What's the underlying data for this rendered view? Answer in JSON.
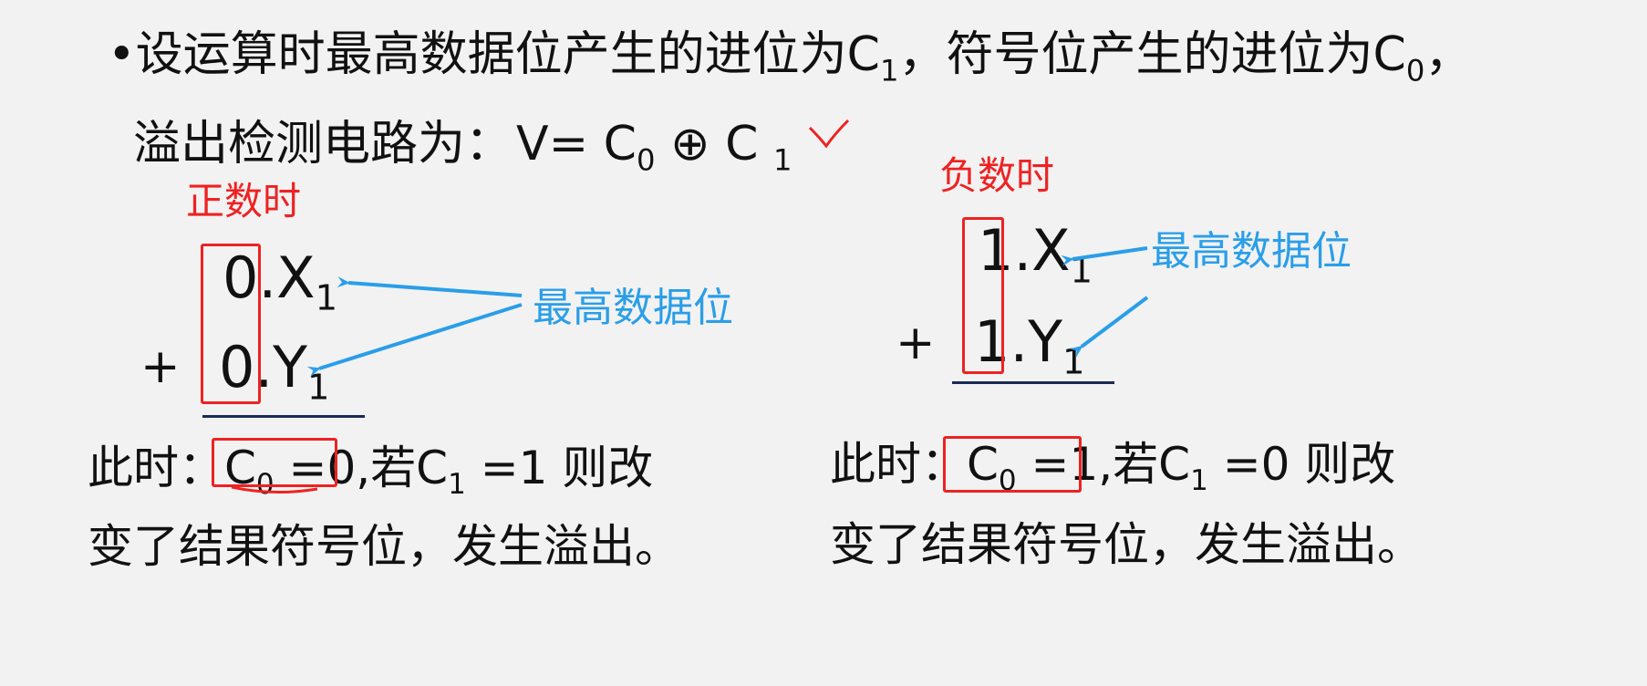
{
  "line1": {
    "bullet": "•",
    "a": "设运算时最高数据位产生的进位为C",
    "a_sub": "1",
    "b": "，符号位产生的进位为C",
    "b_sub": "0",
    "c": "，"
  },
  "line2": {
    "label": "溢出检测电路为：",
    "formula_pre": "V= C",
    "formula_sub0": "0",
    "formula_mid": " ⊕ C ",
    "formula_sub1": "1"
  },
  "positive": {
    "title": "正数时",
    "x_lead": "0",
    "x_rest": ".X",
    "x_sub": "1",
    "plus": "+",
    "y_lead": "0",
    "y_rest": ".Y",
    "y_sub": "1",
    "annotation": "最高数据位",
    "note_a": "此时：",
    "note_c0": "C",
    "note_c0_sub": "0",
    "note_eq": " =0",
    "note_b": ",若C",
    "note_b_sub": "1",
    "note_c": " =1 则改",
    "note_line2": "变了结果符号位，发生溢出。"
  },
  "negative": {
    "title": "负数时",
    "x_lead": "1",
    "x_rest": ".X",
    "x_sub": "1",
    "plus": "+",
    "y_lead": "1",
    "y_rest": ".Y",
    "y_sub": "1",
    "annotation": "最高数据位",
    "note_a": "此时：",
    "note_c0": "C",
    "note_c0_sub": "0",
    "note_eq": " =1",
    "note_b": ",若C",
    "note_b_sub": "1",
    "note_c": " =0 则改",
    "note_line2": "变了结果符号位，发生溢出。"
  },
  "colors": {
    "background": "#f2f2f2",
    "highlight_red": "#ee2222",
    "annotation_blue": "#2a9ee8",
    "rule_navy": "#1b2a55"
  }
}
